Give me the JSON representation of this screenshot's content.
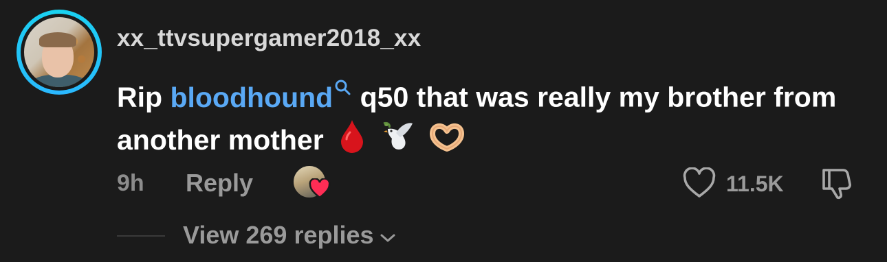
{
  "comment": {
    "username": "xx_ttvsupergamer2018_xx",
    "text_before": "Rip ",
    "mention": "bloodhound",
    "text_after": " q50 that was really my brother from another mother",
    "emojis": [
      "drop-of-blood-icon",
      "dove-icon",
      "heart-hands-icon"
    ],
    "time": "9h",
    "reply_label": "Reply",
    "like_count": "11.5K",
    "view_replies_label": "View 269 replies"
  },
  "colors": {
    "background": "#1b1b1b",
    "mention": "#5aa9f5",
    "avatar_ring": "#19d3f0",
    "heart": "#ff2d55"
  }
}
